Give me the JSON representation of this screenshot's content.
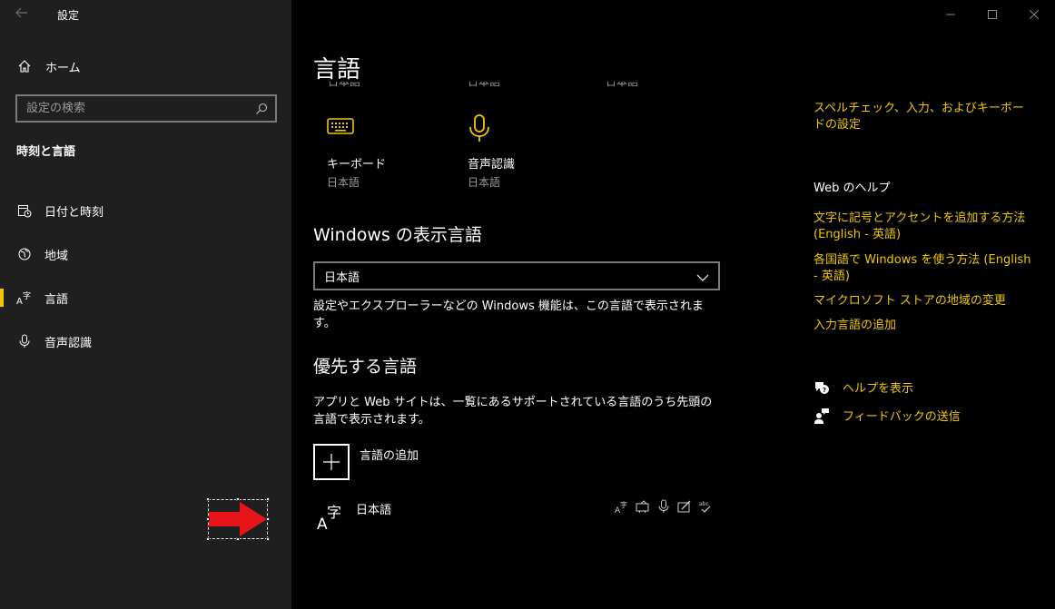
{
  "app": {
    "title": "設定"
  },
  "sidebar": {
    "home_label": "ホーム",
    "search_placeholder": "設定の検索",
    "section_title": "時刻と言語",
    "items": [
      {
        "label": "日付と時刻",
        "icon": "calendar-clock-icon"
      },
      {
        "label": "地域",
        "icon": "globe-icon"
      },
      {
        "label": "言語",
        "icon": "language-icon",
        "active": true
      },
      {
        "label": "音声認識",
        "icon": "microphone-icon"
      }
    ]
  },
  "main": {
    "title": "言語",
    "clipped_labels": [
      "日本語",
      "日本語",
      "日本語"
    ],
    "tiles": [
      {
        "name": "キーボード",
        "sub": "日本語",
        "icon": "keyboard-icon"
      },
      {
        "name": "音声認識",
        "sub": "日本語",
        "icon": "microphone-icon"
      }
    ],
    "display_language": {
      "heading": "Windows の表示言語",
      "selected": "日本語",
      "description": "設定やエクスプローラーなどの Windows 機能は、この言語で表示されます。"
    },
    "preferred": {
      "heading": "優先する言語",
      "description": "アプリと Web サイトは、一覧にあるサポートされている言語のうち先頭の言語で表示されます。",
      "add_label": "言語の追加",
      "languages": [
        {
          "name": "日本語",
          "features": [
            "display-language-icon",
            "text-to-speech-icon",
            "speech-icon",
            "handwriting-icon",
            "spellcheck-icon"
          ]
        }
      ]
    }
  },
  "right": {
    "top_link": "スペルチェック、入力、およびキーボードの設定",
    "web_help_heading": "Web のヘルプ",
    "web_links": [
      "文字に記号とアクセントを追加する方法 (English - 英語)",
      "各国語で Windows を使う方法 (English - 英語)",
      "マイクロソフト ストアの地域の変更",
      "入力言語の追加"
    ],
    "help_label": "ヘルプを表示",
    "feedback_label": "フィードバックの送信"
  },
  "colors": {
    "accent": "#f0c800",
    "sidebar_bg": "#1f1f1f",
    "main_bg": "#000000",
    "annotation_arrow": "#e8141c"
  }
}
